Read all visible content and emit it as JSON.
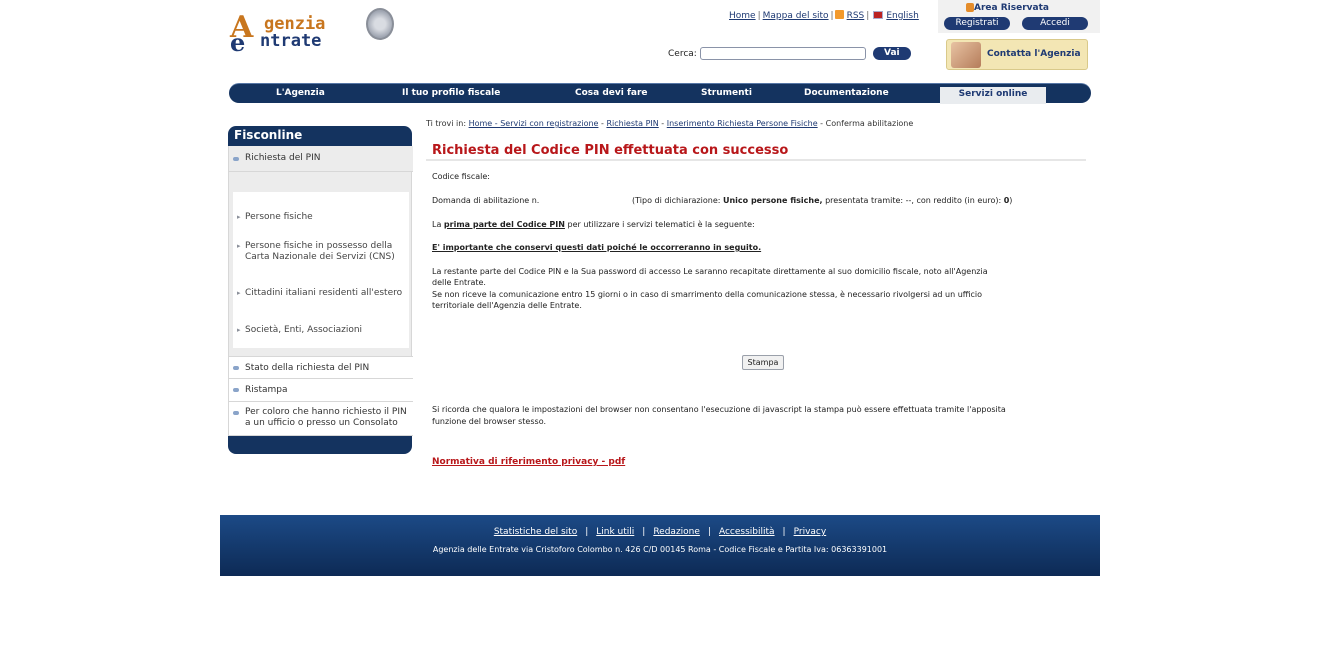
{
  "logo": {
    "line1": "genzia",
    "line2": "ntrate",
    "initial1": "A",
    "initial2": "e"
  },
  "toplinks": {
    "home": "Home",
    "mappa": "Mappa del sito",
    "rss": "RSS",
    "english": "English"
  },
  "search": {
    "label": "Cerca:",
    "value": "",
    "button": "Vai"
  },
  "area": {
    "title": "Area Riservata",
    "registrati": "Registrati",
    "accedi": "Accedi"
  },
  "contatta": {
    "label": "Contatta l'Agenzia"
  },
  "nav": {
    "items": [
      "L'Agenzia",
      "Il tuo profilo fiscale",
      "Cosa devi fare",
      "Strumenti",
      "Documentazione"
    ],
    "active": "Servizi online"
  },
  "sidebar": {
    "title": "Fisconline",
    "richiesta": "Richiesta del PIN",
    "sub": [
      "Persone fisiche",
      "Persone fisiche in possesso della Carta Nazionale dei Servizi (CNS)",
      "Cittadini italiani residenti all'estero",
      "Società, Enti, Associazioni"
    ],
    "stato": "Stato della richiesta del PIN",
    "ristampa": "Ristampa",
    "percoloro": "Per coloro che hanno richiesto il PIN a un ufficio o presso un Consolato"
  },
  "breadcrumb": {
    "prefix": "Ti trovi in:",
    "home": "Home - Servizi con registrazione",
    "pin": "Richiesta PIN",
    "ins": "Inserimento Richiesta Persone Fisiche",
    "current": "Conferma abilitazione"
  },
  "main": {
    "title": "Richiesta del Codice PIN effettuata con successo",
    "codice_fiscale": "Codice fiscale:",
    "domanda": "Domanda di abilitazione n.",
    "tipo_a": "(Tipo di dichiarazione: ",
    "tipo_b": "Unico persone fisiche,",
    "tipo_c": " presentata tramite: --, con reddito (in euro): ",
    "tipo_d": "0",
    "tipo_e": ")",
    "prima_a": "La ",
    "prima_b": "prima parte del Codice PIN",
    "prima_c": " per utilizzare i servizi telematici è la seguente:",
    "importante": "E' importante che conservi questi dati poiché le occorreranno in seguito.",
    "restante1": "La restante parte del Codice PIN e la Sua password di accesso Le saranno recapitate direttamente al suo domicilio fiscale, noto all'Agenzia",
    "restante2": "delle Entrate.",
    "restante3": "Se non riceve la comunicazione entro 15 giorni o in caso di smarrimento della comunicazione stessa, è necessario rivolgersi ad un ufficio",
    "restante4": "territoriale dell'Agenzia delle Entrate.",
    "stampa": "Stampa",
    "ricorda1": "Si ricorda che qualora le impostazioni del browser non consentano l'esecuzione di javascript la stampa può essere effettuata tramite l'apposita",
    "ricorda2": "funzione del browser stesso.",
    "privacy": "Normativa di riferimento privacy - pdf"
  },
  "footer": {
    "links": [
      "Statistiche del sito",
      "Link utili",
      "Redazione",
      "Accessibilità",
      "Privacy"
    ],
    "sep": "|",
    "address": "Agenzia delle Entrate via Cristoforo Colombo n. 426 C/D 00145 Roma - Codice Fiscale e Partita Iva: 06363391001"
  }
}
